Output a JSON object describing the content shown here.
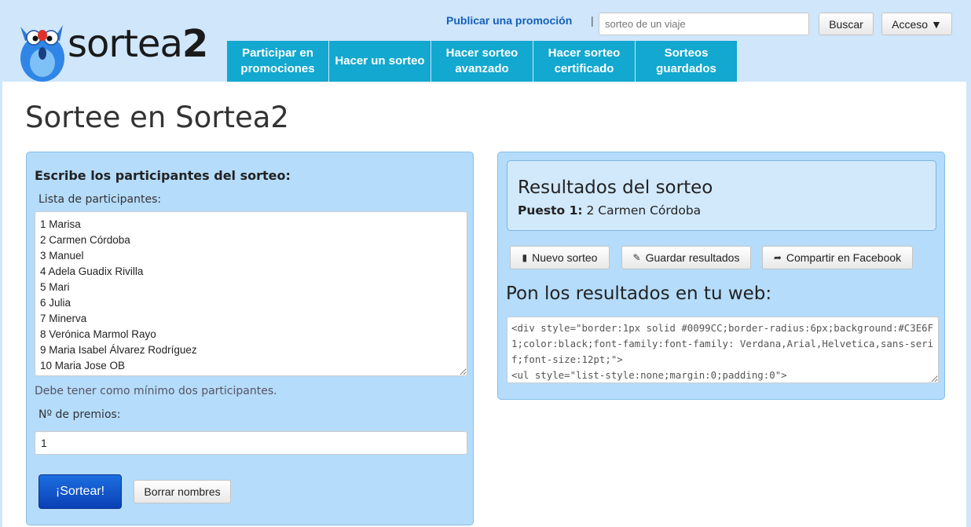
{
  "header": {
    "logo_text_main": "sortea",
    "logo_text_num": "2",
    "promo_link": "Publicar una promoción",
    "separator": "|",
    "search_placeholder": "sorteo de un viaje",
    "search_button": "Buscar",
    "access_button": "Acceso ▼",
    "nav": [
      {
        "label": "Participar en promociones"
      },
      {
        "label": "Hacer un sorteo"
      },
      {
        "label": "Hacer sorteo avanzado"
      },
      {
        "label": "Hacer sorteo certificado"
      },
      {
        "label": "Sorteos guardados"
      }
    ],
    "nav_color": "#12a8cf"
  },
  "page_title": "Sortee en Sortea2",
  "left_panel": {
    "heading": "Escribe los participantes del sorteo:",
    "list_label": "Lista de participantes:",
    "participants": [
      "1 Marisa",
      "2 Carmen Córdoba",
      "3 Manuel",
      "4 Adela Guadix Rivilla",
      "5 Mari",
      "6 Julia",
      "7 Minerva",
      "8 Verónica Marmol Rayo",
      "9 Maria Isabel Álvarez Rodríguez",
      "10 Maria Jose OB"
    ],
    "hint": "Debe tener como mínimo dos participantes.",
    "prizes_label": "Nº de premios:",
    "prizes_value": "1",
    "draw_button": "¡Sortear!",
    "clear_button": "Borrar nombres"
  },
  "right_panel": {
    "results_title": "Resultados del sorteo",
    "result_position_label": "Puesto 1:",
    "result_winner": "2 Carmen Córdoba",
    "new_button": "Nuevo sorteo",
    "save_button": "Guardar resultados",
    "share_button": "Compartir en Facebook",
    "web_title": "Pon los resultados en tu web:",
    "embed_code": "<div style=\"border:1px solid #0099CC;border-radius:6px;background:#C3E6F1;color:black;font-family:font-family: Verdana,Arial,Helvetica,sans-serif;font-size:12pt;\">\n<ul style=\"list-style:none;margin:0;padding:0\">"
  }
}
